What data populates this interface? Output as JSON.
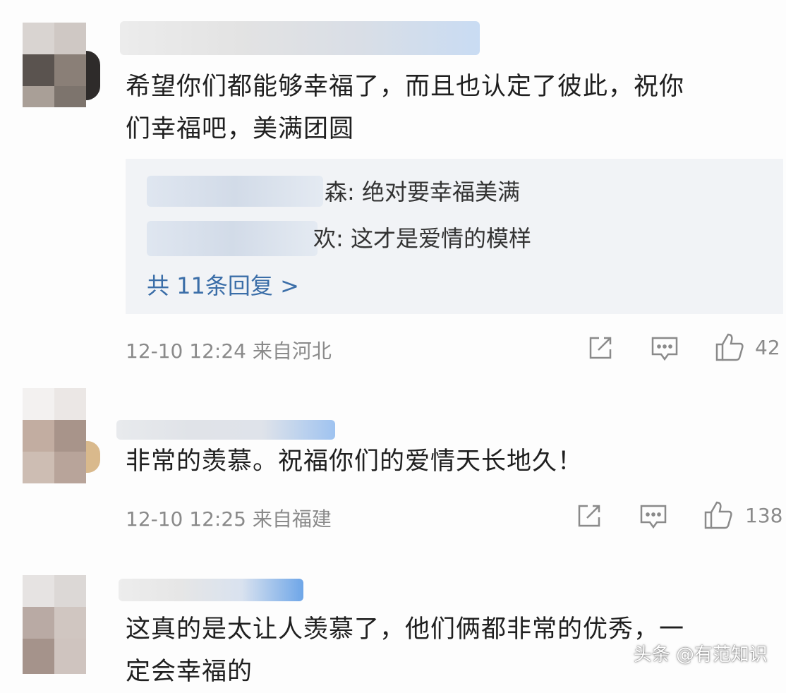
{
  "comments": [
    {
      "text_line1": "希望你们都能够幸福了，而且也认定了彼此，祝你",
      "text_line2": "们幸福吧，美满团圆",
      "replies": [
        {
          "name_tail": "森",
          "text": ": 绝对要幸福美满"
        },
        {
          "name_tail": "欢",
          "text": ": 这才是爱情的模样"
        }
      ],
      "more_replies": "共 11条回复 >",
      "meta": "12-10 12:24  来自河北",
      "likes": "42"
    },
    {
      "text_line1": "非常的羡慕。祝福你们的爱情天长地久！",
      "meta": "12-10 12:25  来自福建",
      "likes": "138"
    },
    {
      "text_line1": "这真的是太让人羡慕了，他们俩都非常的优秀，一",
      "text_line2": "定会幸福的"
    }
  ],
  "icons": [
    "share-icon",
    "comment-icon",
    "like-icon"
  ],
  "watermark": "头条 @有范知识",
  "colors": {
    "link": "#3b6ea8",
    "meta": "#8a8a8a",
    "reply_bg": "#f1f3f6"
  }
}
